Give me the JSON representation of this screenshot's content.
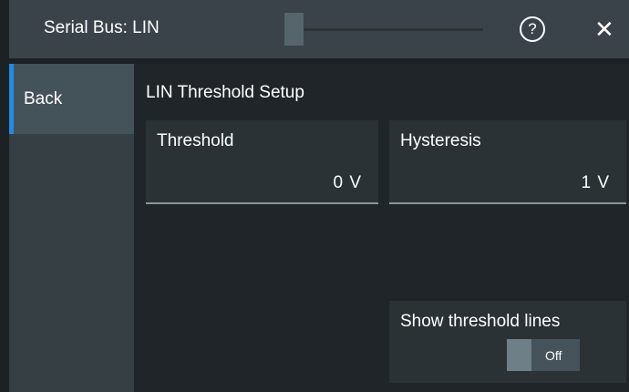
{
  "titlebar": {
    "title": "Serial Bus: LIN",
    "help_symbol": "?",
    "close_symbol": "✕"
  },
  "sidebar": {
    "back_label": "Back"
  },
  "main": {
    "section_title": "LIN Threshold Setup",
    "threshold": {
      "label": "Threshold",
      "value": "0 V"
    },
    "hysteresis": {
      "label": "Hysteresis",
      "value": "1 V"
    },
    "threshold_lines": {
      "label": "Show threshold lines",
      "state": "Off"
    }
  },
  "colors": {
    "accent": "#1f8be6",
    "titlebar": "#3a4349",
    "background": "#1c2124"
  },
  "icons": [
    "help-icon",
    "close-icon"
  ]
}
